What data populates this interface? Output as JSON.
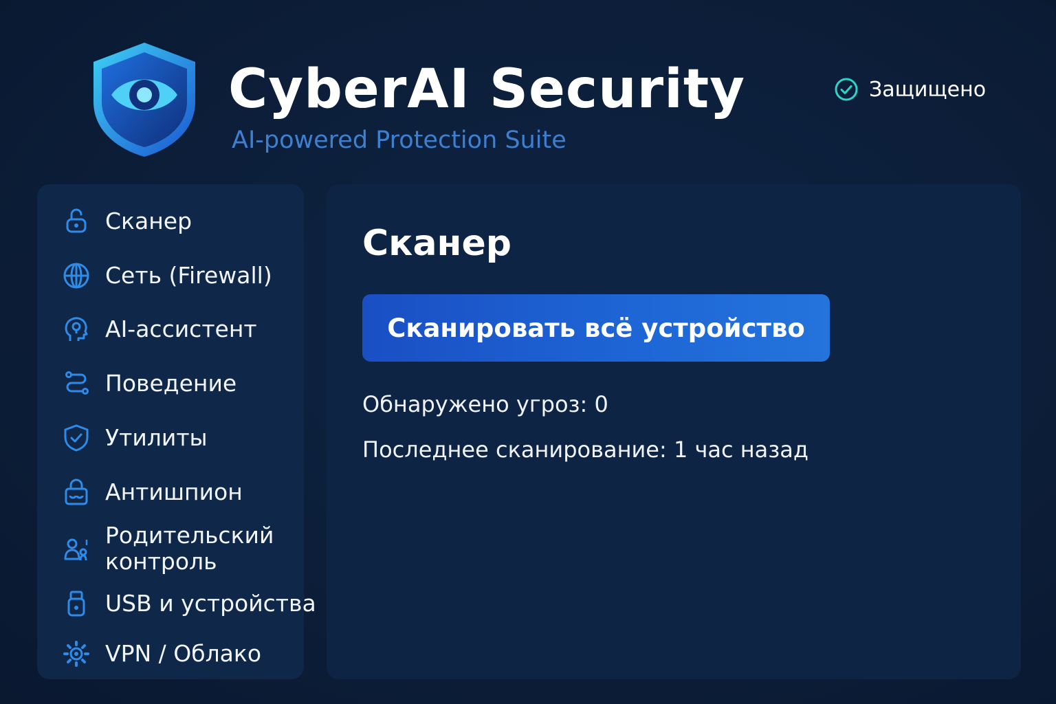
{
  "header": {
    "title": "CyberAI Security",
    "subtitle": "AI-powered Protection Suite",
    "status_label": "Защищено",
    "logo_icon": "shield-eye-icon",
    "status_icon": "check-circle-icon"
  },
  "sidebar": {
    "items": [
      {
        "label": "Сканер",
        "icon": "scanner-icon"
      },
      {
        "label": "Сеть (Firewall)",
        "icon": "globe-icon"
      },
      {
        "label": "AI-ассистент",
        "icon": "ai-head-icon"
      },
      {
        "label": "Поведение",
        "icon": "path-icon"
      },
      {
        "label": "Утилиты",
        "icon": "shield-check-icon"
      },
      {
        "label": "Антишпион",
        "icon": "spy-lock-icon"
      },
      {
        "label": "Родительский контроль",
        "icon": "parent-child-icon"
      },
      {
        "label": "USB и устройства",
        "icon": "usb-icon"
      },
      {
        "label": "VPN / Облако",
        "icon": "cloud-gear-icon"
      }
    ]
  },
  "main": {
    "section_title": "Сканер",
    "scan_button_label": "Сканировать всё устройство",
    "threats_text": "Обнаружено угроз: 0",
    "last_scan_text": "Последнее сканирование: 1 час назад"
  },
  "colors": {
    "background": "#0b1930",
    "panel": "#0e2444",
    "sidebar": "#0f2748",
    "accent": "#1e66d6",
    "icon": "#2f8be8",
    "status_check": "#2fd3c6",
    "subtitle": "#3e7fd0"
  }
}
